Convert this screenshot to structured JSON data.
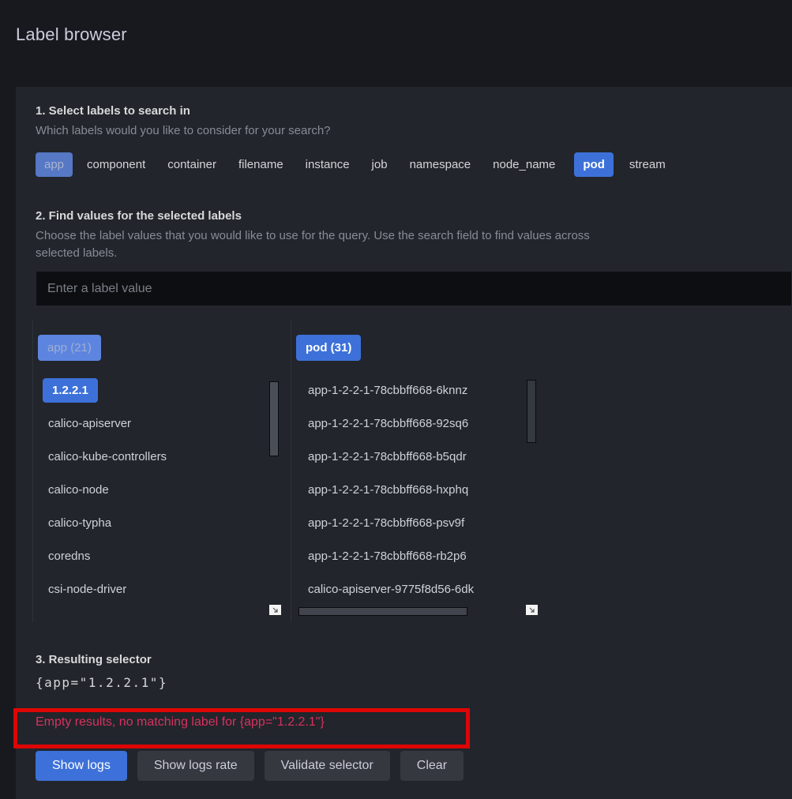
{
  "page": {
    "title": "Label browser"
  },
  "colors": {
    "panel_bg": "#22252b",
    "page_bg": "#17191e",
    "primary_blue": "#3d71d9",
    "muted_blue": "#5678c5",
    "header_chip_blue": "#5d85e0",
    "error_text": "#d8315f",
    "annotation_red": "#de0505"
  },
  "section1": {
    "heading": "1. Select labels to search in",
    "description": "Which labels would you like to consider for your search?",
    "labels": [
      {
        "name": "app",
        "selected": true,
        "style": "muted"
      },
      {
        "name": "component",
        "selected": false
      },
      {
        "name": "container",
        "selected": false
      },
      {
        "name": "filename",
        "selected": false
      },
      {
        "name": "instance",
        "selected": false
      },
      {
        "name": "job",
        "selected": false
      },
      {
        "name": "namespace",
        "selected": false
      },
      {
        "name": "node_name",
        "selected": false
      },
      {
        "name": "pod",
        "selected": true,
        "style": "strong"
      },
      {
        "name": "stream",
        "selected": false
      }
    ]
  },
  "section2": {
    "heading": "2. Find values for the selected labels",
    "description": "Choose the label values that you would like to use for the query. Use the search field to find values across selected labels.",
    "search_placeholder": "Enter a label value"
  },
  "values": {
    "columns": [
      {
        "header": "app (21)",
        "items": [
          {
            "text": "1.2.2.1",
            "selected": true
          },
          {
            "text": "calico-apiserver",
            "selected": false
          },
          {
            "text": "calico-kube-controllers",
            "selected": false
          },
          {
            "text": "calico-node",
            "selected": false
          },
          {
            "text": "calico-typha",
            "selected": false
          },
          {
            "text": "coredns",
            "selected": false
          },
          {
            "text": "csi-node-driver",
            "selected": false
          }
        ]
      },
      {
        "header": "pod (31)",
        "items": [
          {
            "text": "app-1-2-2-1-78cbbff668-6knnz",
            "selected": false
          },
          {
            "text": "app-1-2-2-1-78cbbff668-92sq6",
            "selected": false
          },
          {
            "text": "app-1-2-2-1-78cbbff668-b5qdr",
            "selected": false
          },
          {
            "text": "app-1-2-2-1-78cbbff668-hxphq",
            "selected": false
          },
          {
            "text": "app-1-2-2-1-78cbbff668-psv9f",
            "selected": false
          },
          {
            "text": "app-1-2-2-1-78cbbff668-rb2p6",
            "selected": false
          },
          {
            "text": "calico-apiserver-9775f8d56-6dk",
            "selected": false
          }
        ]
      }
    ]
  },
  "section3": {
    "heading": "3. Resulting selector",
    "selector": "{app=\"1.2.2.1\"}"
  },
  "status": {
    "error_message": "Empty results, no matching label for {app=\"1.2.2.1\"}"
  },
  "buttons": [
    {
      "label": "Show logs",
      "variant": "primary"
    },
    {
      "label": "Show logs rate",
      "variant": "secondary"
    },
    {
      "label": "Validate selector",
      "variant": "secondary"
    },
    {
      "label": "Clear",
      "variant": "secondary"
    }
  ]
}
